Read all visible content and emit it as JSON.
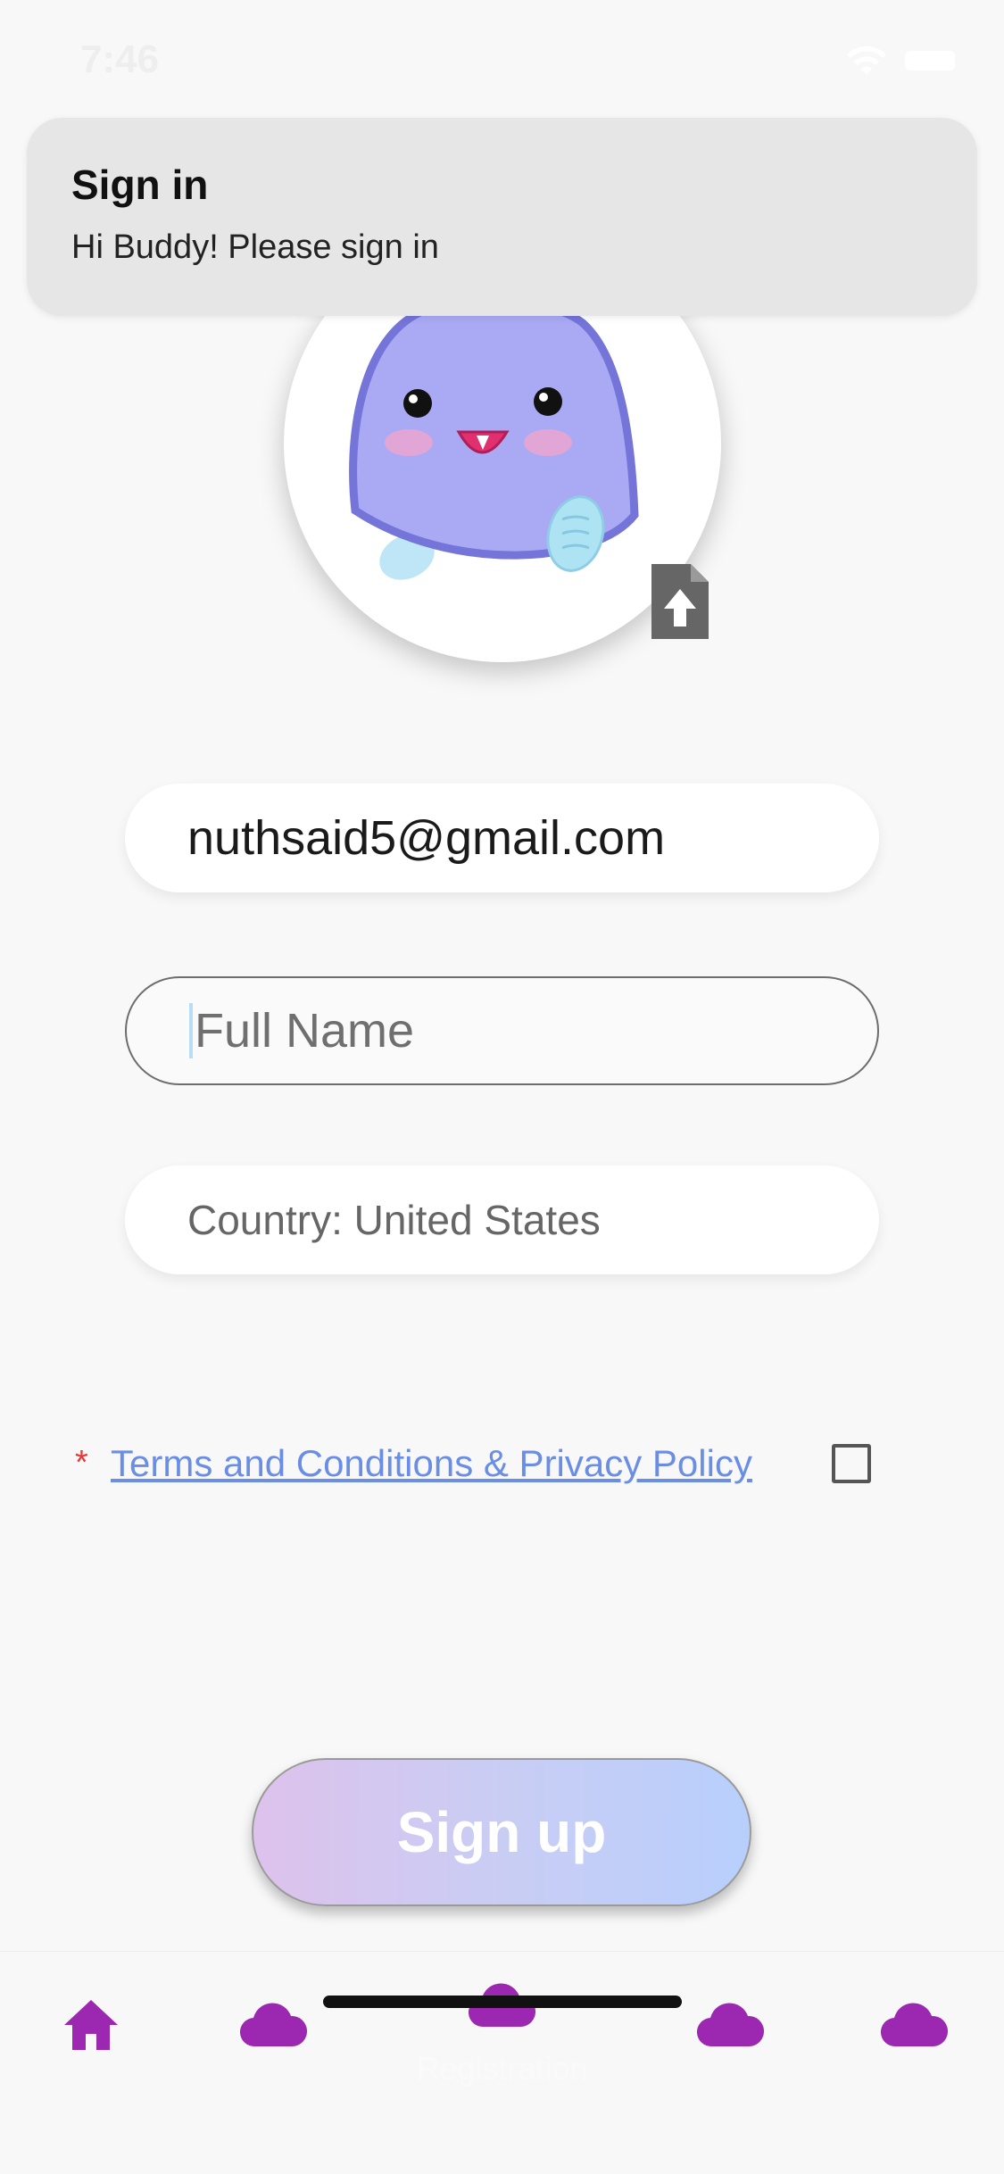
{
  "status_bar": {
    "time": "7:46"
  },
  "toast": {
    "title": "Sign in",
    "message": "Hi Buddy! Please sign in"
  },
  "avatar": {
    "icon": "cute-blob-mascot",
    "upload_icon": "file-upload-icon"
  },
  "form": {
    "email": "nuthsaid5@gmail.com",
    "full_name": {
      "value": "",
      "placeholder": "Full Name"
    },
    "country": "Country: United States"
  },
  "terms": {
    "required_mark": "*",
    "link_text": "Terms and Conditions & Privacy Policy",
    "checked": false
  },
  "signup_button": {
    "label": "Sign up"
  },
  "bottom_nav": {
    "active_label": "Registration",
    "items": [
      "home-icon",
      "cloud-icon",
      "cloud-icon",
      "cloud-icon",
      "cloud-icon"
    ]
  },
  "colors": {
    "accent": "#9c27b0",
    "link": "#6a8ee6",
    "required": "#e53935"
  }
}
